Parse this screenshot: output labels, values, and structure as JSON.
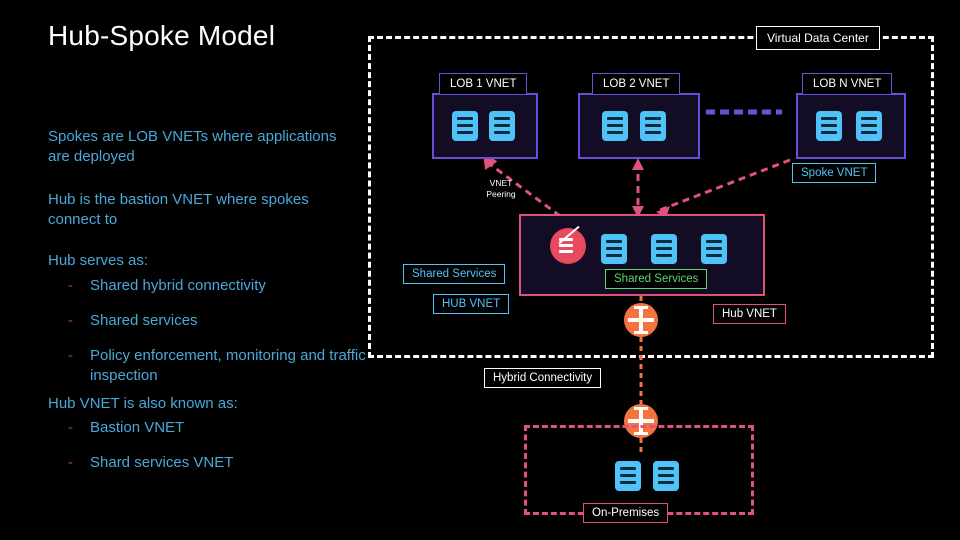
{
  "slide": {
    "title": "Hub-Spoke Model",
    "paragraphs": {
      "p1": "Spokes are LOB VNETs where applications are deployed",
      "p2": "Hub is the bastion VNET where spokes connect to",
      "p3": "Hub serves as:",
      "p4": "Hub VNET is also known as:"
    },
    "bullets_hub_serves": [
      "Shared hybrid connectivity",
      "Shared services",
      "Policy enforcement, monitoring and traffic inspection"
    ],
    "bullets_also_known": [
      "Bastion VNET",
      "Shard services VNET"
    ],
    "bullet_marker": "-"
  },
  "diagram": {
    "vdc_label": "Virtual Data Center",
    "vnets": [
      {
        "label": "LOB 1 VNET",
        "icons": 2
      },
      {
        "label": "LOB 2 VNET",
        "icons": 2
      },
      {
        "label": "LOB N VNET",
        "icons": 2
      }
    ],
    "spoke_vnet_label": "Spoke VNET",
    "vnet_peering_label": "VNET Peering",
    "shared_services_label_left": "Shared Services",
    "shared_services_label_right": "Shared Services",
    "hub_vnet_label_left": "HUB VNET",
    "hub_vnet_label_right": "Hub VNET",
    "hybrid_connectivity_label": "Hybrid Connectivity",
    "on_premises_label": "On-Premises",
    "colors": {
      "background": "#000000",
      "body_text": "#4aa8d8",
      "title_text": "#ffffff",
      "vnet_border": "#6b4fd8",
      "hub_border": "#e0527a",
      "server_icon": "#4fc3f7",
      "firewall_icon": "#e84a5f",
      "gateway_icon": "#f4733f",
      "green_label": "#5bd66b",
      "bullet_dash": "#b03a4a"
    }
  }
}
